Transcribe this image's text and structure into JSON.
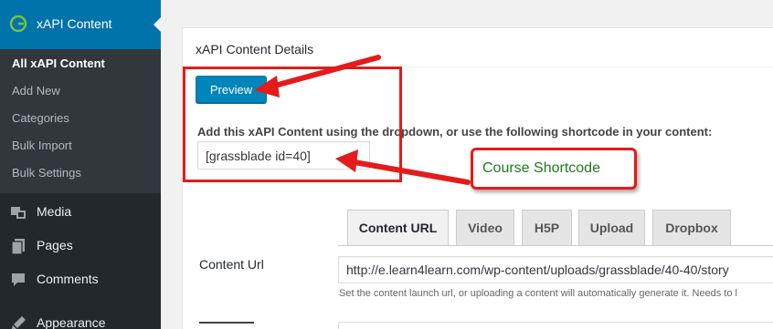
{
  "sidebar": {
    "active_menu": "xAPI Content",
    "submenu": [
      "All xAPI Content",
      "Add New",
      "Categories",
      "Bulk Import",
      "Bulk Settings"
    ],
    "items": [
      {
        "label": "Media",
        "icon": "media-icon"
      },
      {
        "label": "Pages",
        "icon": "pages-icon"
      },
      {
        "label": "Comments",
        "icon": "comments-icon"
      },
      {
        "label": "Appearance",
        "icon": "appearance-icon"
      }
    ]
  },
  "panel": {
    "title": "xAPI Content Details",
    "preview_button": "Preview",
    "shortcode_description": "Add this xAPI Content using the dropdown, or use the following shortcode in your content:",
    "shortcode_value": "[grassblade id=40]",
    "callout_label": "Course Shortcode",
    "tabs": [
      "Content URL",
      "Video",
      "H5P",
      "Upload",
      "Dropbox"
    ],
    "active_tab": "Content URL",
    "content_url_label": "Content Url",
    "content_url_value": "http://e.learn4learn.com/wp-content/uploads/grassblade/40-40/story",
    "content_url_help": "Set the content launch url, or uploading a content will automatically generate it. Needs to l"
  },
  "colors": {
    "sidebar_bg": "#23282d",
    "menu_active": "#0073aa",
    "button": "#0085ba",
    "highlight_red": "#e41b1b",
    "callout_text": "#1f7a1f"
  }
}
